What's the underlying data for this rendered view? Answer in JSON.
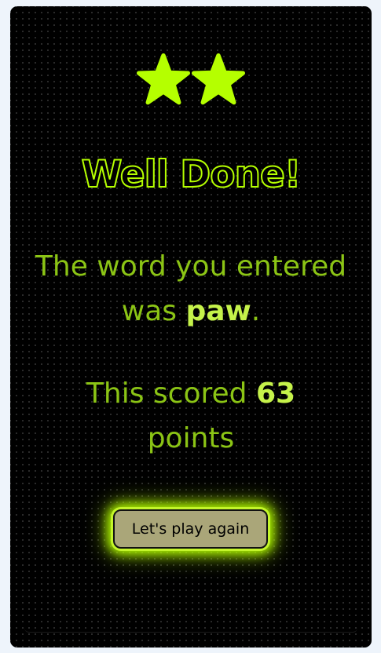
{
  "stars": {
    "count": 2,
    "icon": "star-icon",
    "color": "#b5ff00"
  },
  "result": {
    "title": "Well Done!",
    "word_prefix": "The word you entered was",
    "word": "paw",
    "word_suffix": ".",
    "score_prefix": "This scored",
    "score": "63",
    "score_suffix": "points"
  },
  "actions": {
    "play_again_label": "Let's play again"
  },
  "colors": {
    "accent": "#b5ff00",
    "text": "#8bc415",
    "highlight": "#c5f24a",
    "button_bg": "#aaa679",
    "background": "#000000",
    "page_bg": "#eef4fb"
  }
}
